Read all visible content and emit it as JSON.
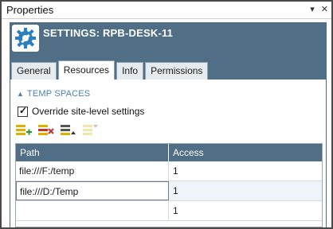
{
  "window": {
    "title": "Properties",
    "icons": {
      "pin": "pin-icon",
      "close": "close-icon"
    }
  },
  "header": {
    "title": "SETTINGS: RPB-DESK-11",
    "icon": "gear-wrench-icon",
    "colors": {
      "background": "#506f86"
    }
  },
  "tabs": [
    {
      "label": "General",
      "active": false
    },
    {
      "label": "Resources",
      "active": true
    },
    {
      "label": "Info",
      "active": false
    },
    {
      "label": "Permissions",
      "active": false
    }
  ],
  "section": {
    "title": "TEMP SPACES",
    "icon": "chevron-up-icon",
    "override": {
      "label": "Override site-level settings",
      "checked": true
    }
  },
  "toolbar": {
    "buttons": [
      {
        "name": "add-row-button",
        "icon": "add-row-icon"
      },
      {
        "name": "delete-row-button",
        "icon": "delete-row-icon"
      },
      {
        "name": "move-up-button",
        "icon": "move-up-icon"
      },
      {
        "name": "filter-button",
        "icon": "filter-icon",
        "enabled": false
      }
    ]
  },
  "grid": {
    "columns": [
      "Path",
      "Access"
    ],
    "rows": [
      {
        "path": "file:///F:/temp",
        "access": "1"
      },
      {
        "path": "file:///D:/Temp",
        "access": "1"
      },
      {
        "path": "",
        "access": "1"
      }
    ]
  },
  "colors": {
    "accent": "#4a7fb0",
    "header": "#506f86"
  }
}
